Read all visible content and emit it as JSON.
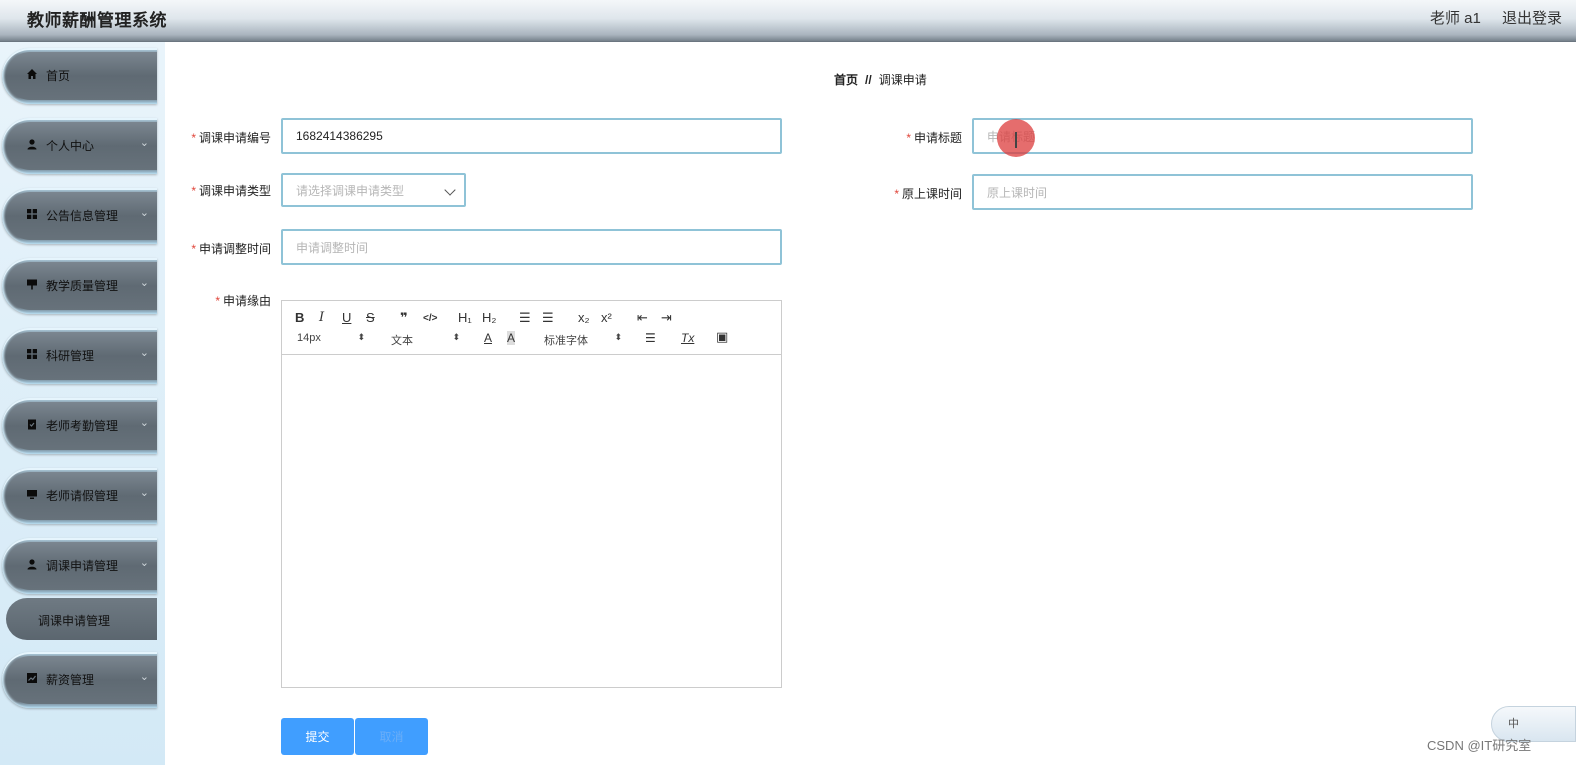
{
  "header": {
    "app_title": "教师薪酬管理系统",
    "user": "老师 a1",
    "logout": "退出登录"
  },
  "sidebar": {
    "items": [
      {
        "label": "首页",
        "icon": "home-icon",
        "arrow": ""
      },
      {
        "label": "个人中心",
        "icon": "user-icon",
        "arrow": "⌄"
      },
      {
        "label": "公告信息管理",
        "icon": "grid-icon",
        "arrow": "⌄"
      },
      {
        "label": "教学质量管理",
        "icon": "board-icon",
        "arrow": "⌄"
      },
      {
        "label": "科研管理",
        "icon": "grid-icon",
        "arrow": "⌄"
      },
      {
        "label": "老师考勤管理",
        "icon": "clipboard-icon",
        "arrow": "⌄"
      },
      {
        "label": "老师请假管理",
        "icon": "monitor-icon",
        "arrow": "⌄"
      },
      {
        "label": "调课申请管理",
        "icon": "user-icon",
        "arrow": "⌄"
      },
      {
        "label": "薪资管理",
        "icon": "chart-icon",
        "arrow": "⌄"
      }
    ],
    "submenu": {
      "label": "调课申请管理"
    }
  },
  "breadcrumb": {
    "home": "首页",
    "separator": "//",
    "current": "调课申请"
  },
  "form": {
    "required_mark": "*",
    "number": {
      "label": "调课申请编号",
      "value": "1682414386295"
    },
    "title": {
      "label": "申请标题",
      "placeholder": "申请标题"
    },
    "type": {
      "label": "调课申请类型",
      "placeholder": "请选择调课申请类型"
    },
    "original_time": {
      "label": "原上课时间",
      "placeholder": "原上课时间"
    },
    "adjust_time": {
      "label": "申请调整时间",
      "placeholder": "申请调整时间"
    },
    "reason": {
      "label": "申请缘由"
    }
  },
  "editor": {
    "buttons": {
      "bold": "B",
      "italic": "I",
      "underline": "U",
      "strike": "S",
      "quote": "❞",
      "code": "</>",
      "h1": "H₁",
      "h2": "H₂",
      "ordered_list": "☰",
      "bullet_list": "☰",
      "subscript": "x₂",
      "superscript": "x²",
      "outdent": "⇤",
      "indent": "⇥",
      "font_color": "A",
      "background": "A",
      "align": "☰",
      "clean": "Tx",
      "image": "▣"
    },
    "size_select": "14px",
    "header_select": "文本",
    "font_select": "标准字体"
  },
  "actions": {
    "submit": "提交",
    "cancel": "取消"
  },
  "ime": {
    "label": "中"
  },
  "watermark": "CSDN @IT研究室",
  "colors": {
    "primary": "#409eff",
    "input_border": "#8fc3d7",
    "required": "#e0453a"
  }
}
